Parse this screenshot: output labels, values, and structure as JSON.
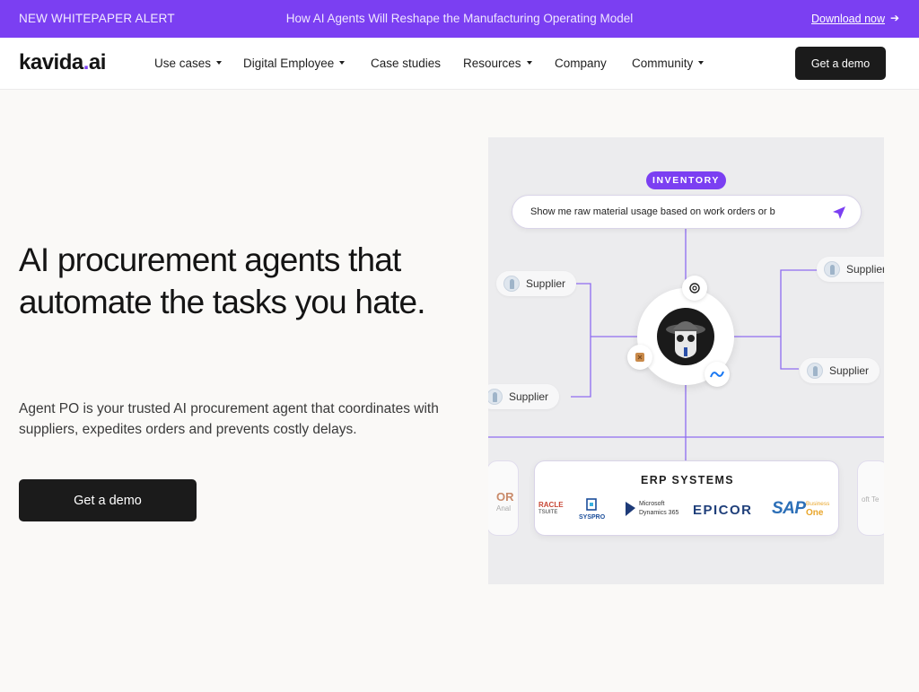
{
  "announcement": {
    "tag": "NEW WHITEPAPER ALERT",
    "message": "How AI Agents Will Reshape the Manufacturing Operating Model",
    "link": "Download now",
    "arrow": "➔"
  },
  "nav": {
    "logo_main": "kavida",
    "logo_dot": ".",
    "logo_suffix": "ai",
    "items": [
      {
        "label": "Use cases",
        "dropdown": true
      },
      {
        "label": "Digital Employee",
        "dropdown": true
      },
      {
        "label": "Case studies",
        "dropdown": false
      },
      {
        "label": "Resources",
        "dropdown": true
      },
      {
        "label": "Company",
        "dropdown": false
      },
      {
        "label": "Community",
        "dropdown": true
      }
    ],
    "cta": "Get a demo"
  },
  "hero": {
    "headline": "AI procurement agents that automate the tasks you hate.",
    "subtext": "Agent PO is your trusted AI procurement agent that coordinates with suppliers, expedites orders and prevents costly delays.",
    "cta": "Get a demo"
  },
  "illustration": {
    "pill": "INVENTORY",
    "query": "Show me raw material usage based on work orders or b",
    "suppliers": [
      "Supplier",
      "Supplier",
      "Supplier",
      "Supplier"
    ],
    "erp_title": "ERP SYSTEMS",
    "erp_logos": {
      "oracle": "RACLE",
      "oracle_sub": "TSUITE",
      "syspro": "SYSPRO",
      "microsoft_1": "Microsoft",
      "microsoft_2": "Dynamics 365",
      "epicor": "EPICOR",
      "sap": "SAP",
      "sap_business": "Business",
      "sap_one": "One"
    },
    "left_card_1": "OR",
    "left_card_2": "Anal",
    "right_card": "oft Te",
    "colors": {
      "accent": "#7b3ff2",
      "epicor": "#1f3f7a",
      "sap_blue": "#2c6fb7",
      "sap_gold": "#e9a62b"
    }
  }
}
